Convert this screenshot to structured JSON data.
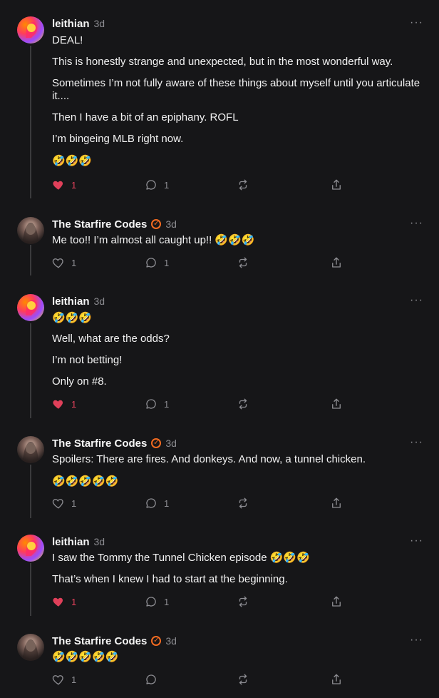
{
  "posts": [
    {
      "author": "leithian",
      "avatar": "leithian",
      "verified": false,
      "time": "3d",
      "more": "···",
      "paragraphs": [
        "DEAL!",
        "This is honestly strange and unexpected, but in the most wonderful way.",
        "Sometimes I’m not fully aware of these things about myself until you articulate it....",
        "Then I have a bit of an epiphany. ROFL",
        "I’m bingeing MLB right now.",
        "🤣🤣🤣"
      ],
      "likes": "1",
      "liked": true,
      "replies": "1"
    },
    {
      "author": "The Starfire Codes",
      "avatar": "starfire",
      "verified": true,
      "time": "3d",
      "more": "···",
      "paragraphs": [
        "Me too!! I’m almost all caught up!! 🤣🤣🤣"
      ],
      "likes": "1",
      "liked": false,
      "replies": "1"
    },
    {
      "author": "leithian",
      "avatar": "leithian",
      "verified": false,
      "time": "3d",
      "more": "···",
      "paragraphs": [
        "🤣🤣🤣",
        "Well, what are the odds?",
        "I’m not betting!",
        "Only on #8."
      ],
      "likes": "1",
      "liked": true,
      "replies": "1"
    },
    {
      "author": "The Starfire Codes",
      "avatar": "starfire",
      "verified": true,
      "time": "3d",
      "more": "···",
      "paragraphs": [
        "Spoilers: There are fires. And donkeys. And now, a tunnel chicken.",
        "🤣🤣🤣🤣🤣"
      ],
      "likes": "1",
      "liked": false,
      "replies": "1"
    },
    {
      "author": "leithian",
      "avatar": "leithian",
      "verified": false,
      "time": "3d",
      "more": "···",
      "paragraphs": [
        "I saw the Tommy the Tunnel Chicken episode 🤣🤣🤣",
        "That’s when I knew I had to start at the beginning."
      ],
      "likes": "1",
      "liked": true,
      "replies": "1"
    },
    {
      "author": "The Starfire Codes",
      "avatar": "starfire",
      "verified": true,
      "time": "3d",
      "more": "···",
      "paragraphs": [
        "🤣🤣🤣🤣🤣"
      ],
      "likes": "1",
      "liked": false,
      "replies": ""
    }
  ],
  "icons": {
    "like": "heart-icon",
    "reply": "comment-icon",
    "restack": "restack-icon",
    "share": "share-icon",
    "more": "more-icon",
    "verified": "verified-badge-icon"
  },
  "colors": {
    "background": "#161618",
    "text": "#f2f2f2",
    "muted": "#8d8d92",
    "liked": "#e0405a",
    "verified": "#f26b21"
  }
}
